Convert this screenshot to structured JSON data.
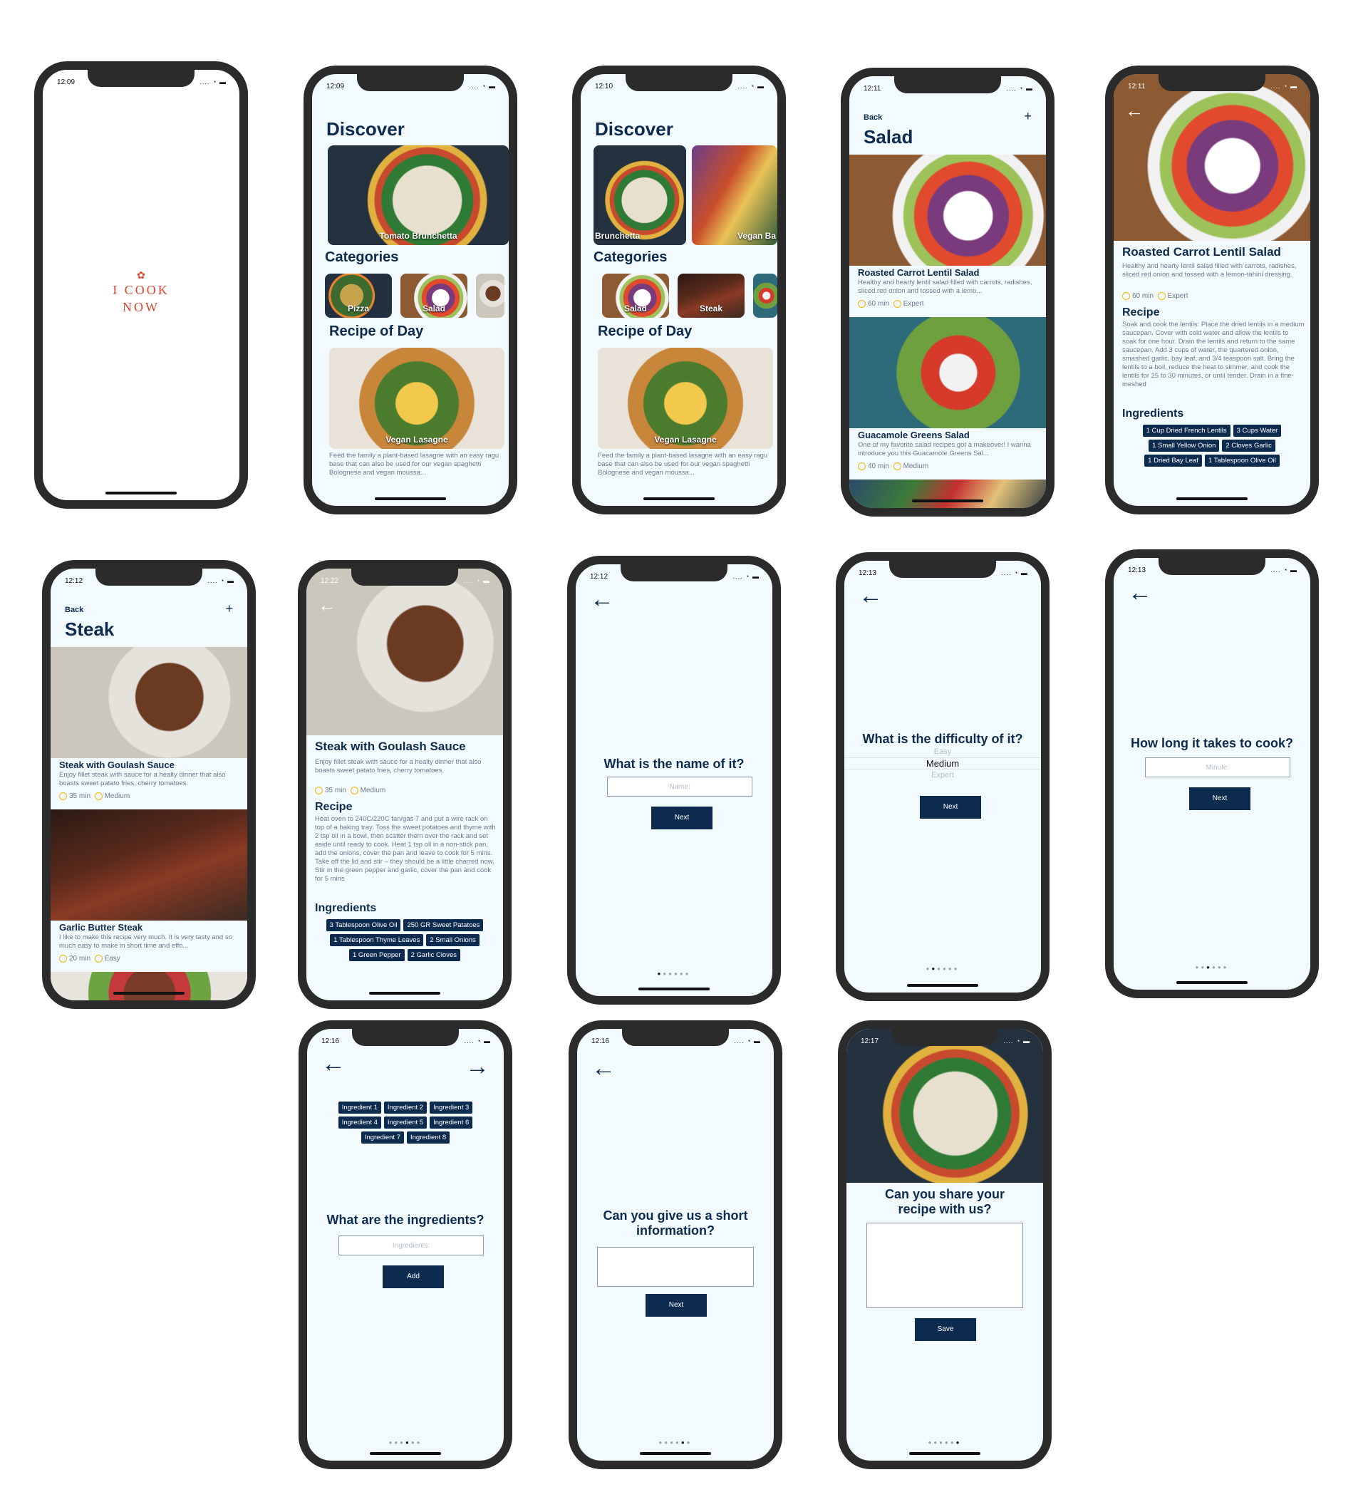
{
  "splash": {
    "time": "12:09",
    "logo_line1": "I COOK",
    "logo_line2": "NOW"
  },
  "discover1": {
    "time": "12:09",
    "title": "Discover",
    "hero_caption": "Tomato Brunchetta",
    "categories_title": "Categories",
    "categories": [
      "Pizza",
      "Salad"
    ],
    "recipe_title": "Recipe of Day",
    "recipe_caption": "Vegan Lasagne",
    "recipe_desc": "Feed the family a plant-based lasagne with an easy ragu base that can also be used for our vegan spaghetti Bolognese and vegan moussa..."
  },
  "discover2": {
    "time": "12:10",
    "title": "Discover",
    "hero_caption1": "Brunchetta",
    "hero_caption2": "Vegan Ba",
    "categories_title": "Categories",
    "categories": [
      "Salad",
      "Steak"
    ],
    "recipe_title": "Recipe of Day",
    "recipe_caption": "Vegan Lasagne",
    "recipe_desc": "Feed the family a plant-based lasagne with an easy ragu base that can also be used for our vegan spaghetti Bolognese and vegan moussa..."
  },
  "salad": {
    "time": "12:11",
    "back": "Back",
    "plus": "+",
    "title": "Salad",
    "card1": {
      "title": "Roasted Carrot Lentil Salad",
      "desc": "Healthy and hearty lentil salad filled with carrots, radishes, sliced red onion and tossed with a lemo...",
      "time": "60 min",
      "level": "Expert"
    },
    "card2": {
      "title": "Guacamole Greens Salad",
      "desc": "One of my favorite salad recipes got a makeover! I wanna introduce you this Guacamole Greens Sal...",
      "time": "40 min",
      "level": "Medium"
    }
  },
  "salad_detail": {
    "time": "12:11",
    "title": "Roasted Carrot Lentil Salad",
    "desc": "Healthy and hearty lentil salad filled with carrots, radishes, sliced red onion and tossed with a lemon-tahini dressing.",
    "time_label": "60 min",
    "level": "Expert",
    "recipe_title": "Recipe",
    "recipe_text": "Soak and cook the lentils: Place the dried lentils in a medium saucepan. Cover with cold water and allow the lentils to soak for one hour. Drain the lentils and return to the same saucepan. Add 3 cups of water, the quartered onion, smashed garlic, bay leaf, and 3/4 teaspoon salt. Bring the lentils to a boil, reduce the heat to simmer, and cook the lentils for 25 to 30 minutes, or until tender. Drain in a fine-meshed",
    "ingredients_title": "Ingredients",
    "ingredients": [
      "1 Cup Dried French Lentils",
      "3 Cups Water",
      "1 Small Yellow Onion",
      "2 Cloves Garlic",
      "1 Dried Bay Leaf",
      "1 Tablespoon Olive Oil"
    ]
  },
  "steak": {
    "time": "12:12",
    "back": "Back",
    "plus": "+",
    "title": "Steak",
    "card1": {
      "title": "Steak with Goulash Sauce",
      "desc": "Enjoy fillet steak with sauce for a healty dinner that also boasts sweet patato fries, cherry tomatoes.",
      "time": "35 min",
      "level": "Medium"
    },
    "card2": {
      "title": "Garlic Butter Steak",
      "desc": "I like to make this recipe very much. It is very tasty and so much easy to make in short time and effo...",
      "time": "20 min",
      "level": "Easy"
    }
  },
  "steak_detail": {
    "time": "12:22",
    "title": "Steak with Goulash Sauce",
    "desc": "Enjoy fillet steak with sauce for a healty dinner that also boasts sweet patato fries, cherry tomatoes.",
    "time_label": "35 min",
    "level": "Medium",
    "recipe_title": "Recipe",
    "recipe_text": "Heat oven to 240C/220C fan/gas 7 and put a wire rack on top of a baking tray. Toss the sweet potatoes and thyme with 2 tsp oil in a bowl, then scatter them over the rack and set aside until ready to cook. Heat 1 tsp oil in a non-stick pan, add the onions, cover the pan and leave to cook for 5 mins. Take off the lid and stir – they should be a little charred now. Stir in the green pepper and garlic, cover the pan and cook for 5 mins",
    "ingredients_title": "Ingredients",
    "ingredients": [
      "3 Tablespoon Olive Oil",
      "250 GR Sweet Patatoes",
      "1 Tablespoon Thyme Leaves",
      "2 Small Onions",
      "1 Green Pepper",
      "2 Garlic Cloves"
    ]
  },
  "q_name": {
    "time": "12:12",
    "question": "What is the name of it?",
    "placeholder": "Name:",
    "button": "Next"
  },
  "q_difficulty": {
    "time": "12:13",
    "question": "What is the difficulty of it?",
    "options": [
      "Easy",
      "Medium",
      "Expert"
    ],
    "button": "Next"
  },
  "q_time": {
    "time": "12:13",
    "question": "How long it takes to cook?",
    "placeholder": "Minute:",
    "button": "Next"
  },
  "q_ingredients": {
    "time": "12:16",
    "question": "What are the ingredients?",
    "placeholder": "Ingredients:",
    "button": "Add",
    "chips": [
      "Ingredient 1",
      "Ingredient 2",
      "Ingredient 3",
      "Ingredient 4",
      "Ingredient 5",
      "Ingredient 6",
      "Ingredient 7",
      "Ingredient 8"
    ]
  },
  "q_info": {
    "time": "12:16",
    "question": "Can you give us a short information?",
    "button": "Next"
  },
  "q_share": {
    "time": "12:17",
    "question": "Can you share your recipe with us?",
    "button": "Save"
  },
  "icons": {
    "back_arrow": "←",
    "forward_arrow": "→"
  },
  "colors": {
    "primary": "#0d2b4e",
    "accent": "#d9452f",
    "star": "#f2b807"
  }
}
